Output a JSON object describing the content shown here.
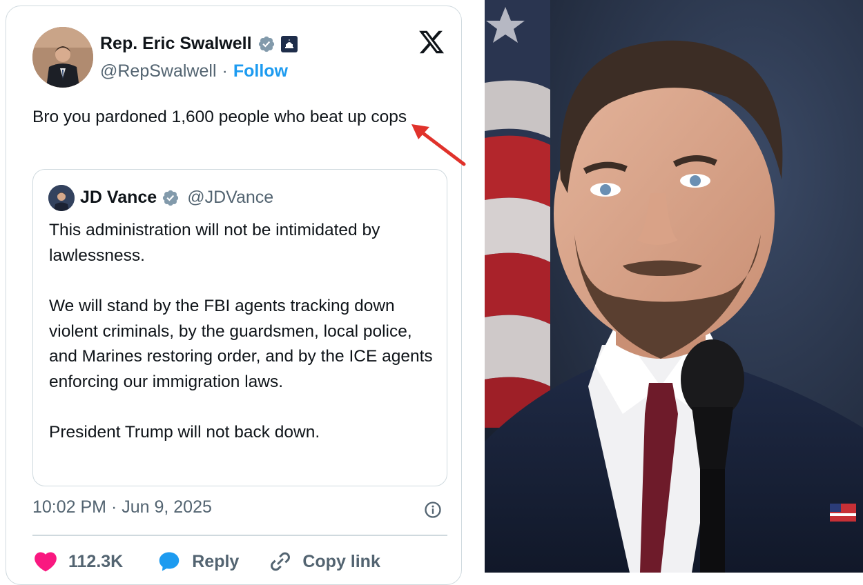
{
  "tweet": {
    "author_name": "Rep. Eric Swalwell",
    "handle": "@RepSwalwell",
    "separator": "·",
    "follow_label": "Follow",
    "text": "Bro you pardoned 1,600 people who beat up cops",
    "timestamp": "10:02 PM · Jun 9, 2025",
    "likes": "112.3K",
    "reply_label": "Reply",
    "copy_link_label": "Copy link"
  },
  "quote": {
    "author_name": "JD Vance",
    "handle": "@JDVance",
    "paragraphs": [
      "This administration will not be intimidated by lawlessness.",
      "We will stand by the FBI agents tracking down violent criminals, by the guardsmen, local police, and Marines restoring order, and by the ICE agents enforcing our immigration laws.",
      "President Trump will not back down."
    ]
  },
  "icons": {
    "verified": "verified-badge-icon",
    "government": "capitol-icon",
    "platform": "x-logo-icon",
    "info": "info-icon",
    "like": "heart-icon",
    "reply": "chat-bubble-icon",
    "copy_link": "link-icon",
    "annotation": "red-arrow-icon"
  },
  "colors": {
    "accent": "#1d9bf0",
    "like": "#f91880",
    "verified": "#829aab",
    "arrow": "#e0322b",
    "muted_text": "#536471",
    "border": "#cfd9de"
  }
}
